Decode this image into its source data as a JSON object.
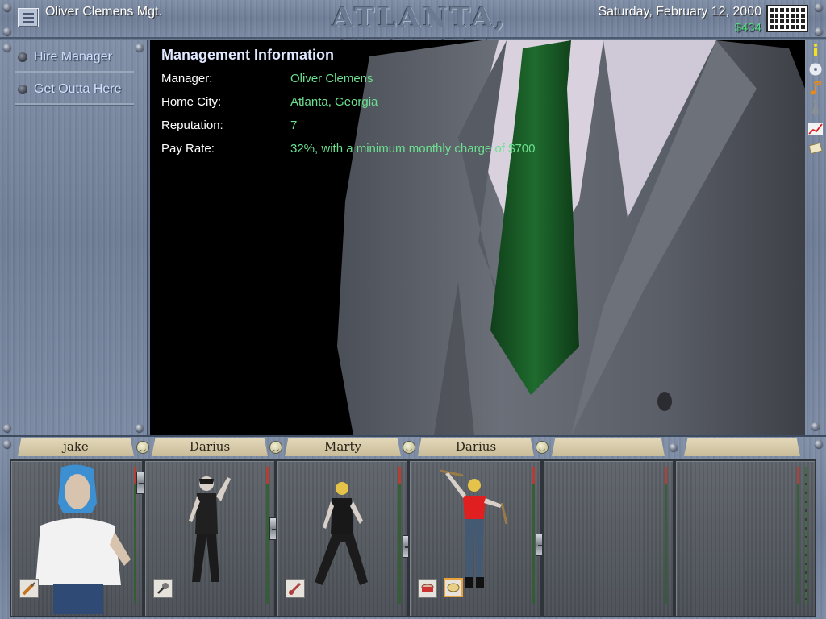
{
  "header": {
    "management_name": "Oliver Clemens Mgt.",
    "city": "ATLANTA, GEORGIA",
    "date": "Saturday, February 12, 2000",
    "money": "$434",
    "menu_icon": "menu-list-icon",
    "calendar_icon": "calendar-icon"
  },
  "menu": {
    "items": [
      {
        "label": "Hire Manager"
      },
      {
        "label": "Get Outta Here"
      }
    ]
  },
  "info": {
    "title": "Management Information",
    "rows": [
      {
        "key": "Manager:",
        "value": "Oliver Clemens"
      },
      {
        "key": "Home City:",
        "value": "Atlanta, Georgia"
      },
      {
        "key": "Reputation:",
        "value": "7"
      },
      {
        "key": "Pay Rate:",
        "value": "32%, with a minimum monthly charge of $700"
      }
    ]
  },
  "side_icons": [
    "info-icon",
    "cd-icon",
    "music-note-icon",
    "tie-icon",
    "chart-icon",
    "ticket-icon"
  ],
  "band": {
    "members": [
      {
        "name": "jake",
        "instruments": [
          "guitar-icon"
        ],
        "selected": 0
      },
      {
        "name": "Darius",
        "instruments": [
          "microphone-icon"
        ],
        "selected": 0
      },
      {
        "name": "Marty",
        "instruments": [
          "bass-guitar-icon"
        ],
        "selected": 0
      },
      {
        "name": "Darius",
        "instruments": [
          "drum-icon",
          "tambourine-icon"
        ],
        "selected": 1
      },
      {
        "name": "",
        "instruments": []
      },
      {
        "name": "",
        "instruments": []
      }
    ]
  },
  "colors": {
    "accent_green": "#6be08f",
    "money_green": "#4fe07a",
    "panel_blue": "#7a89a2"
  }
}
